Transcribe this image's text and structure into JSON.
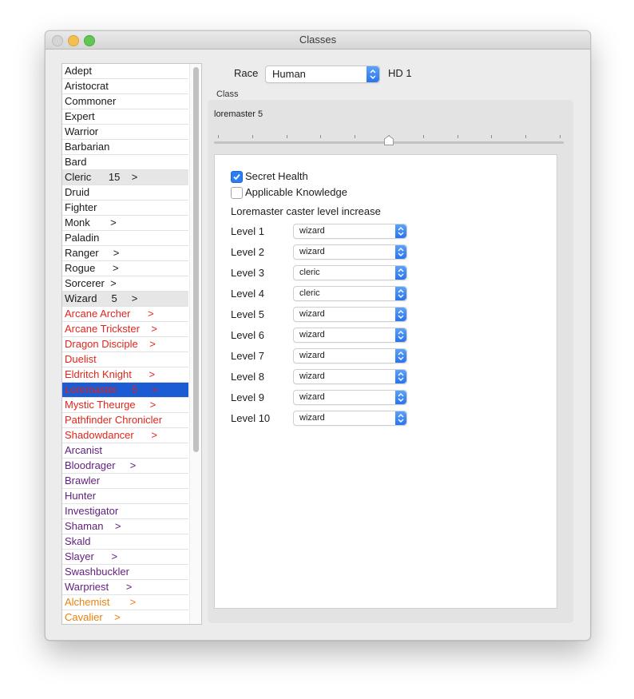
{
  "window": {
    "title": "Classes"
  },
  "class_list": [
    {
      "label": "Adept",
      "color": "black",
      "selection": "none"
    },
    {
      "label": "Aristocrat",
      "color": "black",
      "selection": "none"
    },
    {
      "label": "Commoner",
      "color": "black",
      "selection": "none"
    },
    {
      "label": "Expert",
      "color": "black",
      "selection": "none"
    },
    {
      "label": "Warrior",
      "color": "black",
      "selection": "none"
    },
    {
      "label": "Barbarian",
      "color": "black",
      "selection": "none"
    },
    {
      "label": "Bard",
      "color": "black",
      "selection": "none"
    },
    {
      "label": "Cleric      15    >",
      "color": "black",
      "selection": "gray"
    },
    {
      "label": "Druid",
      "color": "black",
      "selection": "none"
    },
    {
      "label": "Fighter",
      "color": "black",
      "selection": "none"
    },
    {
      "label": "Monk       >",
      "color": "black",
      "selection": "none"
    },
    {
      "label": "Paladin",
      "color": "black",
      "selection": "none"
    },
    {
      "label": "Ranger     >",
      "color": "black",
      "selection": "none"
    },
    {
      "label": "Rogue      >",
      "color": "black",
      "selection": "none"
    },
    {
      "label": "Sorcerer  >",
      "color": "black",
      "selection": "none"
    },
    {
      "label": "Wizard     5     >",
      "color": "black",
      "selection": "gray"
    },
    {
      "label": "Arcane Archer      >",
      "color": "red",
      "selection": "none"
    },
    {
      "label": "Arcane Trickster    >",
      "color": "red",
      "selection": "none"
    },
    {
      "label": "Dragon Disciple    >",
      "color": "red",
      "selection": "none"
    },
    {
      "label": "Duelist",
      "color": "red",
      "selection": "none"
    },
    {
      "label": "Eldritch Knight      >",
      "color": "red",
      "selection": "none"
    },
    {
      "label": "Loremaster     5     >",
      "color": "red",
      "selection": "blue"
    },
    {
      "label": "Mystic Theurge     >",
      "color": "red",
      "selection": "none"
    },
    {
      "label": "Pathfinder Chronicler",
      "color": "red",
      "selection": "none"
    },
    {
      "label": "Shadowdancer      >",
      "color": "red",
      "selection": "none"
    },
    {
      "label": "Arcanist",
      "color": "purple",
      "selection": "none"
    },
    {
      "label": "Bloodrager     >",
      "color": "purple",
      "selection": "none"
    },
    {
      "label": "Brawler",
      "color": "purple",
      "selection": "none"
    },
    {
      "label": "Hunter",
      "color": "purple",
      "selection": "none"
    },
    {
      "label": "Investigator",
      "color": "purple",
      "selection": "none"
    },
    {
      "label": "Shaman    >",
      "color": "purple",
      "selection": "none"
    },
    {
      "label": "Skald",
      "color": "purple",
      "selection": "none"
    },
    {
      "label": "Slayer      >",
      "color": "purple",
      "selection": "none"
    },
    {
      "label": "Swashbuckler",
      "color": "purple",
      "selection": "none"
    },
    {
      "label": "Warpriest      >",
      "color": "purple",
      "selection": "none"
    },
    {
      "label": "Alchemist       >",
      "color": "orange",
      "selection": "none"
    },
    {
      "label": "Cavalier    >",
      "color": "orange",
      "selection": "none"
    }
  ],
  "race": {
    "label": "Race",
    "value": "Human",
    "hd": "HD 1"
  },
  "class_panel": {
    "group_label": "Class",
    "slider_value": "loremaster 5",
    "slider_level_fraction": 0.5,
    "checkboxes": [
      {
        "label": "Secret Health",
        "checked": true
      },
      {
        "label": "Applicable Knowledge",
        "checked": false
      }
    ],
    "caster_title": "Loremaster caster level increase",
    "levels": [
      {
        "label": "Level 1",
        "value": "wizard"
      },
      {
        "label": "Level 2",
        "value": "wizard"
      },
      {
        "label": "Level 3",
        "value": "cleric"
      },
      {
        "label": "Level 4",
        "value": "cleric"
      },
      {
        "label": "Level 5",
        "value": "wizard"
      },
      {
        "label": "Level 6",
        "value": "wizard"
      },
      {
        "label": "Level 7",
        "value": "wizard"
      },
      {
        "label": "Level 8",
        "value": "wizard"
      },
      {
        "label": "Level 9",
        "value": "wizard"
      },
      {
        "label": "Level 10",
        "value": "wizard"
      }
    ]
  },
  "colors": {
    "black": "#1a1a1a",
    "red": "#e0261c",
    "purple": "#62217f",
    "orange": "#e8820c",
    "selection_blue": "#1b5bd3",
    "selection_gray": "#e6e6e6",
    "accent_blue": "#2a7ff0"
  }
}
